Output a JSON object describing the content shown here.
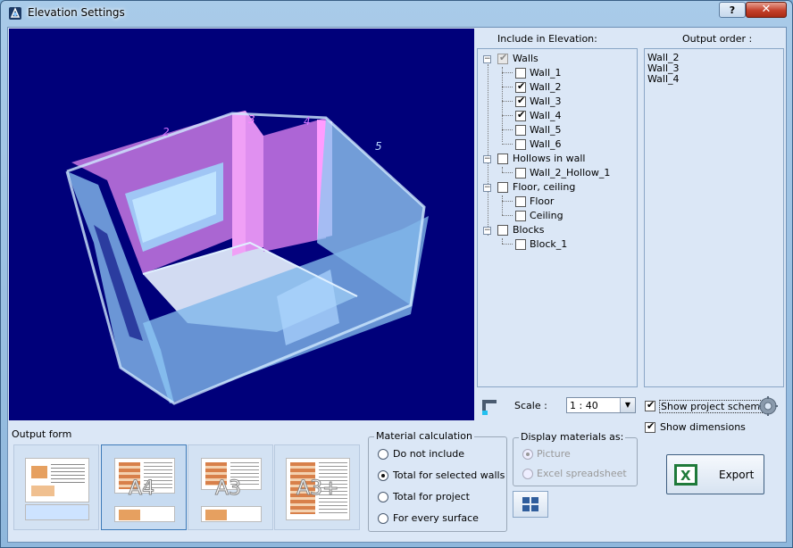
{
  "window": {
    "title": "Elevation Settings",
    "help_label": "?",
    "close_label": "✕"
  },
  "include": {
    "label": "Include in Elevation:",
    "walls": {
      "label": "Walls",
      "items": [
        {
          "label": "Wall_1",
          "checked": false
        },
        {
          "label": "Wall_2",
          "checked": true
        },
        {
          "label": "Wall_3",
          "checked": true
        },
        {
          "label": "Wall_4",
          "checked": true
        },
        {
          "label": "Wall_5",
          "checked": false
        },
        {
          "label": "Wall_6",
          "checked": false
        }
      ]
    },
    "hollows": {
      "label": "Hollows in wall",
      "items": [
        {
          "label": "Wall_2_Hollow_1",
          "checked": false
        }
      ]
    },
    "floor": {
      "label": "Floor, ceiling",
      "items": [
        {
          "label": "Floor",
          "checked": false
        },
        {
          "label": "Ceiling",
          "checked": false
        }
      ]
    },
    "blocks": {
      "label": "Blocks",
      "items": [
        {
          "label": "Block_1",
          "checked": false
        }
      ]
    }
  },
  "order": {
    "label": "Output order :",
    "items": [
      "Wall_2",
      "Wall_3",
      "Wall_4"
    ]
  },
  "scale": {
    "label": "Scale :",
    "value": "1 : 40"
  },
  "options": {
    "show_scheme": "Show project scheme",
    "show_dimensions": "Show dimensions"
  },
  "output_form": {
    "label": "Output form",
    "formats": [
      "A4",
      "A3",
      "A3+"
    ]
  },
  "material": {
    "label": "Material calculation",
    "options": [
      "Do not include",
      "Total for selected walls",
      "Total for project",
      "For every surface"
    ],
    "selected": 1
  },
  "display": {
    "label": "Display materials as:",
    "options": [
      "Picture",
      "Excel spreadsheet"
    ],
    "selected": 0
  },
  "export": {
    "label": "Export",
    "icon_text": "X"
  },
  "viewport": {
    "wall_numbers": [
      "2",
      "3",
      "4",
      "5"
    ]
  },
  "colors": {
    "viewport_bg": "#00007a",
    "selected_wall": "#d680e8",
    "wall": "#9fd0f8",
    "title_bar": "#9cc3e6"
  }
}
